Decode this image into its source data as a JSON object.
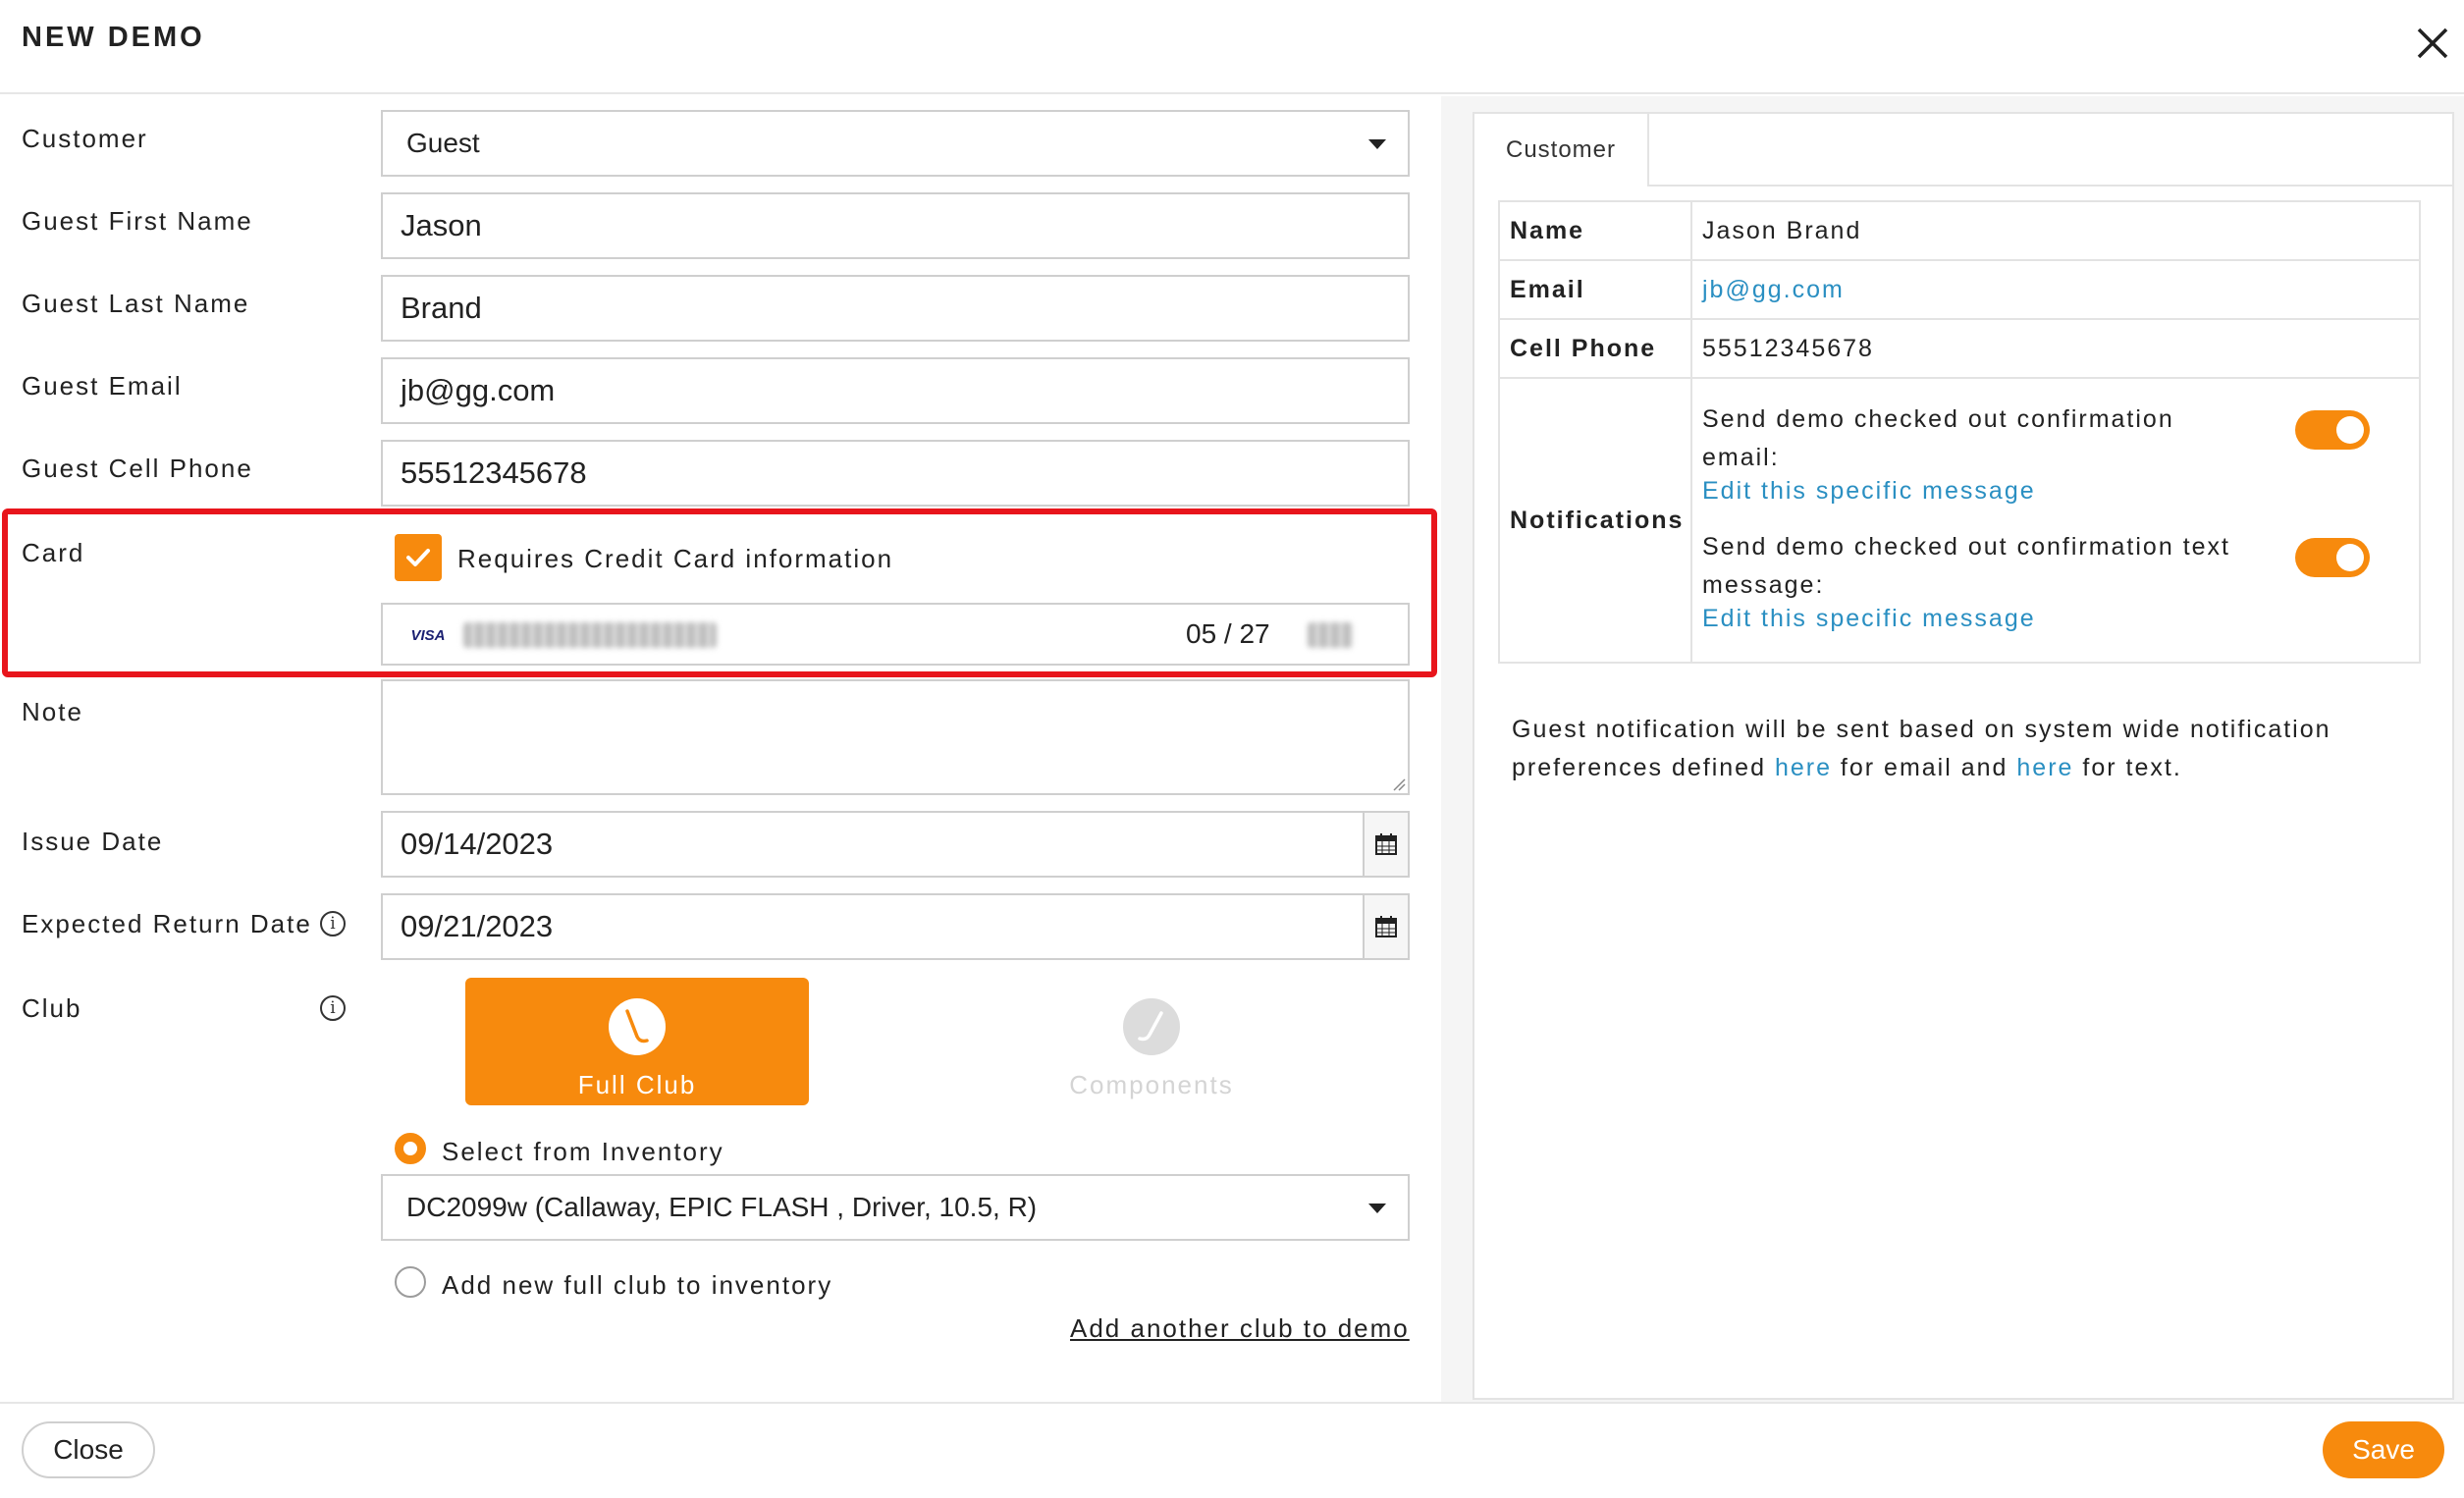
{
  "header": {
    "title": "NEW DEMO"
  },
  "form": {
    "customer": {
      "label": "Customer",
      "value": "Guest"
    },
    "first_name": {
      "label": "Guest First Name",
      "value": "Jason"
    },
    "last_name": {
      "label": "Guest Last Name",
      "value": "Brand"
    },
    "email": {
      "label": "Guest Email",
      "value": "jb@gg.com"
    },
    "cell": {
      "label": "Guest Cell Phone",
      "value": "55512345678"
    },
    "card": {
      "label": "Card",
      "checkbox_label": "Requires Credit Card information",
      "checked": true,
      "brand": "VISA",
      "expiry": "05 / 27"
    },
    "note": {
      "label": "Note",
      "value": ""
    },
    "issue_date": {
      "label": "Issue Date",
      "value": "09/14/2023"
    },
    "return_date": {
      "label": "Expected Return Date",
      "value": "09/21/2023"
    },
    "club": {
      "label": "Club",
      "options": [
        {
          "label": "Full Club",
          "selected": true
        },
        {
          "label": "Components",
          "selected": false
        }
      ],
      "select_inventory": "Select from Inventory",
      "inventory_value": "DC2099w (Callaway, EPIC FLASH , Driver, 10.5, R)",
      "add_new": "Add new full club to inventory",
      "add_another": "Add another club to demo"
    }
  },
  "panel": {
    "tab": "Customer",
    "rows": [
      {
        "key": "Name",
        "value": "Jason Brand"
      },
      {
        "key": "Email",
        "value": "jb@gg.com"
      },
      {
        "key": "Cell Phone",
        "value": "55512345678"
      }
    ],
    "notifications": {
      "key": "Notifications",
      "items": [
        {
          "text": "Send demo checked out confirmation email:",
          "link": "Edit this specific message",
          "enabled": true
        },
        {
          "text": "Send demo checked out confirmation text message:",
          "link": "Edit this specific message",
          "enabled": true
        }
      ]
    },
    "footnote": {
      "part1": "Guest notification will be sent based on system wide notification preferences defined ",
      "link1": "here",
      "part2": " for email and ",
      "link2": "here",
      "part3": " for text."
    }
  },
  "footer": {
    "close": "Close",
    "save": "Save"
  },
  "colors": {
    "accent": "#f78a0d",
    "link": "#2a8fc2",
    "highlight": "#e8151c"
  }
}
